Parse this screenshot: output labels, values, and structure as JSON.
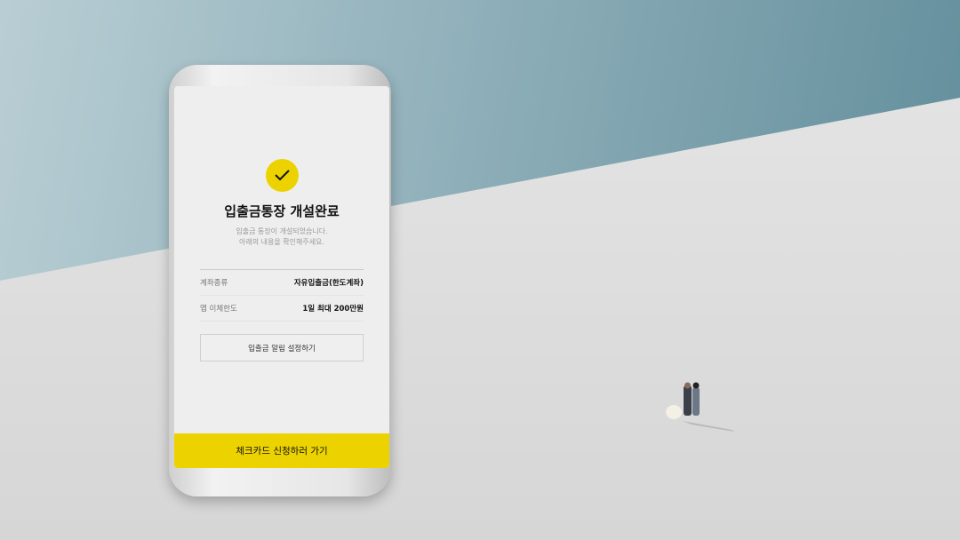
{
  "screen": {
    "title": "입출금통장 개설완료",
    "subtitle_line1": "입출금 통장이 개설되었습니다.",
    "subtitle_line2": "아래의 내용을 확인해주세요.",
    "rows": [
      {
        "label": "계좌종류",
        "value": "자유입출금(한도계좌)"
      },
      {
        "label": "앱 이체한도",
        "value": "1일 최대 200만원"
      }
    ],
    "alert_button": "입출금 알림 설정하기",
    "cta_button": "체크카드 신청하러 가기"
  },
  "colors": {
    "accent": "#ecd300",
    "sky": "#5f8c99"
  },
  "icons": {
    "success": "check-icon"
  }
}
